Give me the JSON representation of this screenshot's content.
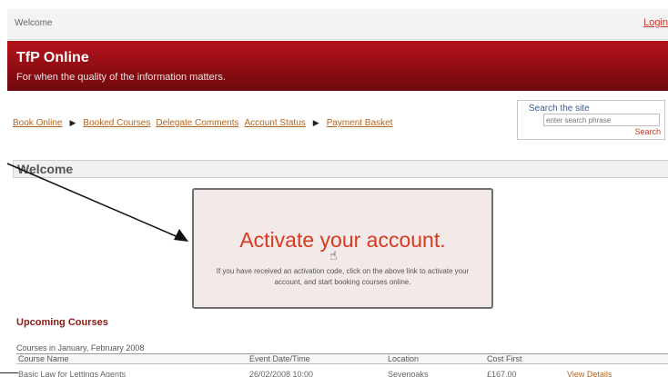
{
  "topbar": {
    "welcome": "Welcome",
    "login": "Login"
  },
  "banner": {
    "title": "TfP Online",
    "tagline": "For when the quality of the information matters."
  },
  "nav": {
    "items": [
      "Book Online",
      "Booked Courses",
      "Delegate Comments",
      "Account Status",
      "Payment Basket"
    ]
  },
  "search": {
    "label": "Search the site",
    "placeholder": "enter search phrase",
    "button": "Search"
  },
  "welcome_heading": "Welcome",
  "activate": {
    "cta": "Activate your account.",
    "info": "If you have received an activation code, click on the above link to activate your account, and start booking courses online."
  },
  "upcoming": {
    "title": "Upcoming Courses",
    "period": "Courses in January, February 2008",
    "columns": [
      "Course Name",
      "Event Date/Time",
      "Location",
      "Cost First"
    ],
    "rows": [
      {
        "course": "Basic Law for Lettings Agents",
        "date": "26/02/2008 10:00",
        "location": "Sevenoaks",
        "cost": "£167.00",
        "action": "View Details"
      }
    ]
  }
}
